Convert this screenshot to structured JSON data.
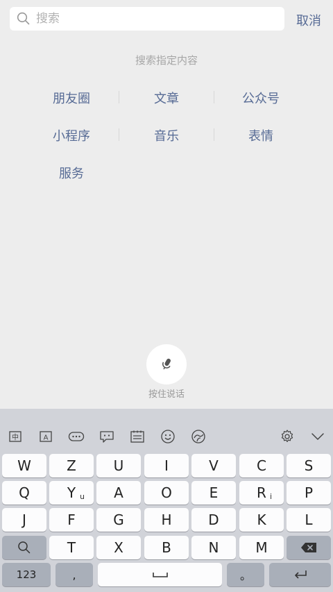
{
  "search": {
    "placeholder": "搜索",
    "value": ""
  },
  "cancel_label": "取消",
  "hint": "搜索指定内容",
  "categories": [
    "朋友圈",
    "文章",
    "公众号",
    "小程序",
    "音乐",
    "表情",
    "服务"
  ],
  "voice_label": "按住说话",
  "keyboard": {
    "toolbar_icons": [
      "chinese-input-icon",
      "english-input-icon",
      "keyboard-icon",
      "chat-icon",
      "clipboard-icon",
      "emoji-icon",
      "sticker-icon",
      "gear-icon",
      "collapse-icon"
    ],
    "toolbar_glyphs": {
      "zh": "中",
      "en": "A"
    },
    "row1": [
      "W",
      "Z",
      "U",
      "I",
      "V",
      "C",
      "S"
    ],
    "row2": [
      "Q",
      "Y",
      "A",
      "O",
      "E",
      "R",
      "P"
    ],
    "row2_sub": {
      "Y": "u",
      "R": "i"
    },
    "row3": [
      "J",
      "F",
      "G",
      "H",
      "D",
      "K",
      "L"
    ],
    "row4": [
      "T",
      "X",
      "B",
      "N",
      "M"
    ],
    "num_label": "123",
    "comma_label": ",",
    "period_label": "。"
  }
}
